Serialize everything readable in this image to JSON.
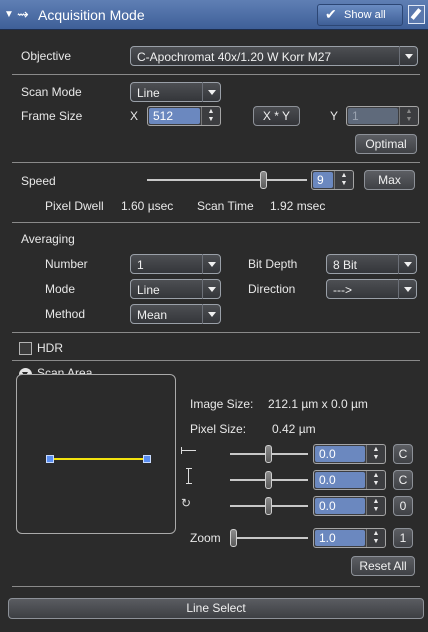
{
  "header": {
    "title": "Acquisition Mode",
    "show_all_label": "Show all"
  },
  "objective": {
    "label": "Objective",
    "value": "C-Apochromat 40x/1.20 W Korr M27"
  },
  "scan_mode": {
    "label": "Scan Mode",
    "value": "Line"
  },
  "frame_size": {
    "label": "Frame Size",
    "x_label": "X",
    "x_value": "512",
    "swap_button": "X * Y",
    "y_label": "Y",
    "y_value": "1",
    "optimal_button": "Optimal"
  },
  "speed": {
    "label": "Speed",
    "value": "9",
    "max_button": "Max",
    "slider_fraction": 0.74,
    "pixel_dwell_label": "Pixel Dwell",
    "pixel_dwell_value": "1.60 µsec",
    "scan_time_label": "Scan Time",
    "scan_time_value": "1.92 msec"
  },
  "averaging": {
    "label": "Averaging",
    "number_label": "Number",
    "number_value": "1",
    "bit_depth_label": "Bit Depth",
    "bit_depth_value": "8 Bit",
    "mode_label": "Mode",
    "mode_value": "Line",
    "direction_label": "Direction",
    "direction_value": "--->",
    "method_label": "Method",
    "method_value": "Mean"
  },
  "hdr": {
    "label": "HDR"
  },
  "scan_area": {
    "label": "Scan Area",
    "image_size_label": "Image Size:",
    "image_size_value": "212.1  µm x 0.0 µm",
    "pixel_size_label": "Pixel Size:",
    "pixel_size_value": "0.42 µm",
    "offset_x_value": "0.0",
    "offset_x_reset": "C",
    "offset_y_value": "0.0",
    "offset_y_reset": "C",
    "rotation_value": "0.0",
    "rotation_reset": "0",
    "zoom_label": "Zoom",
    "zoom_value": "1.0",
    "zoom_reset": "1",
    "reset_all_button": "Reset All"
  },
  "line_select_button": "Line Select",
  "colors": {
    "header": "#4f6fa6",
    "selection": "#6b88bf",
    "scan_line": "#f3e20f",
    "handle": "#5a8ef0",
    "background": "#2b2b2b"
  }
}
